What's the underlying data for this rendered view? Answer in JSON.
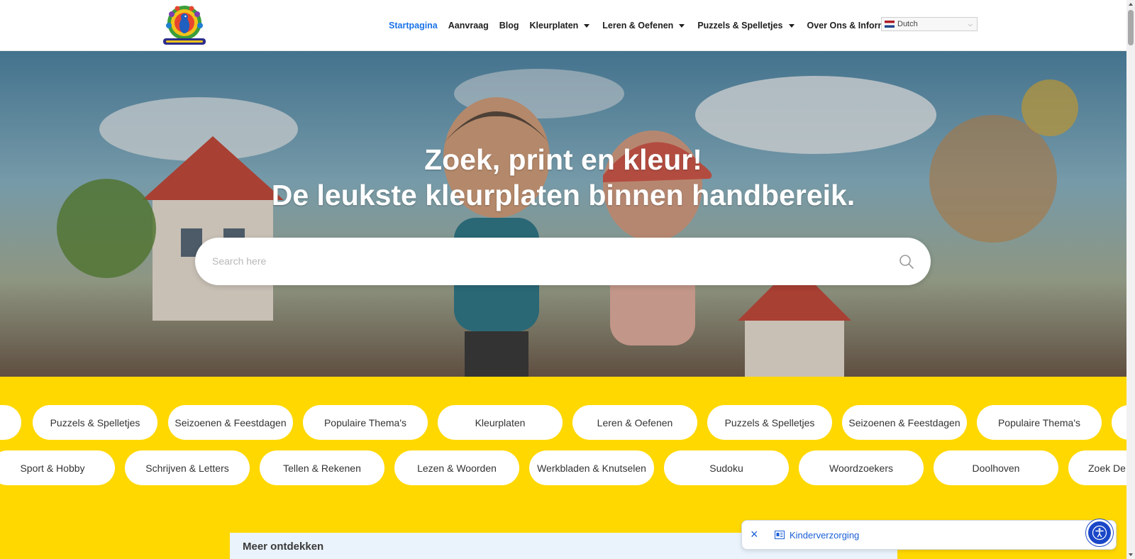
{
  "header": {
    "logo_icon": "peacock-logo",
    "nav": [
      {
        "label": "Startpagina",
        "active": true,
        "dropdown": false
      },
      {
        "label": "Aanvraag",
        "active": false,
        "dropdown": false
      },
      {
        "label": "Blog",
        "active": false,
        "dropdown": false
      },
      {
        "label": "Kleurplaten",
        "active": false,
        "dropdown": true
      },
      {
        "label": "Leren & Oefenen",
        "active": false,
        "dropdown": true
      },
      {
        "label": "Puzzels & Spelletjes",
        "active": false,
        "dropdown": true
      },
      {
        "label": "Over Ons & Informatie",
        "active": false,
        "dropdown": true
      }
    ],
    "language": {
      "selected": "Dutch",
      "flag_icon": "netherlands-flag"
    }
  },
  "hero": {
    "title_line1": "Zoek, print en kleur!",
    "title_line2": "De leukste kleurplaten binnen handbereik.",
    "search_placeholder": "Search here",
    "search_value": ""
  },
  "categories": {
    "row1": [
      "Puzzels & Spelletjes",
      "Seizoenen & Feestdagen",
      "Populaire Thema's",
      "Kleurplaten",
      "Leren & Oefenen",
      "Puzzels & Spelletjes",
      "Seizoenen & Feestdagen",
      "Populaire Thema's"
    ],
    "row2": [
      "Sport & Hobby",
      "Schrijven & Letters",
      "Tellen & Rekenen",
      "Lezen & Woorden",
      "Werkbladen & Knutselen",
      "Sudoku",
      "Woordzoekers",
      "Doolhoven",
      "Zoek De"
    ]
  },
  "meer": {
    "title": "Meer ontdekken"
  },
  "notification": {
    "label": "Kinderverzorging"
  },
  "colors": {
    "accent": "#1a73e8",
    "section_bg": "#ffd800",
    "a11y": "#1a47c8"
  }
}
